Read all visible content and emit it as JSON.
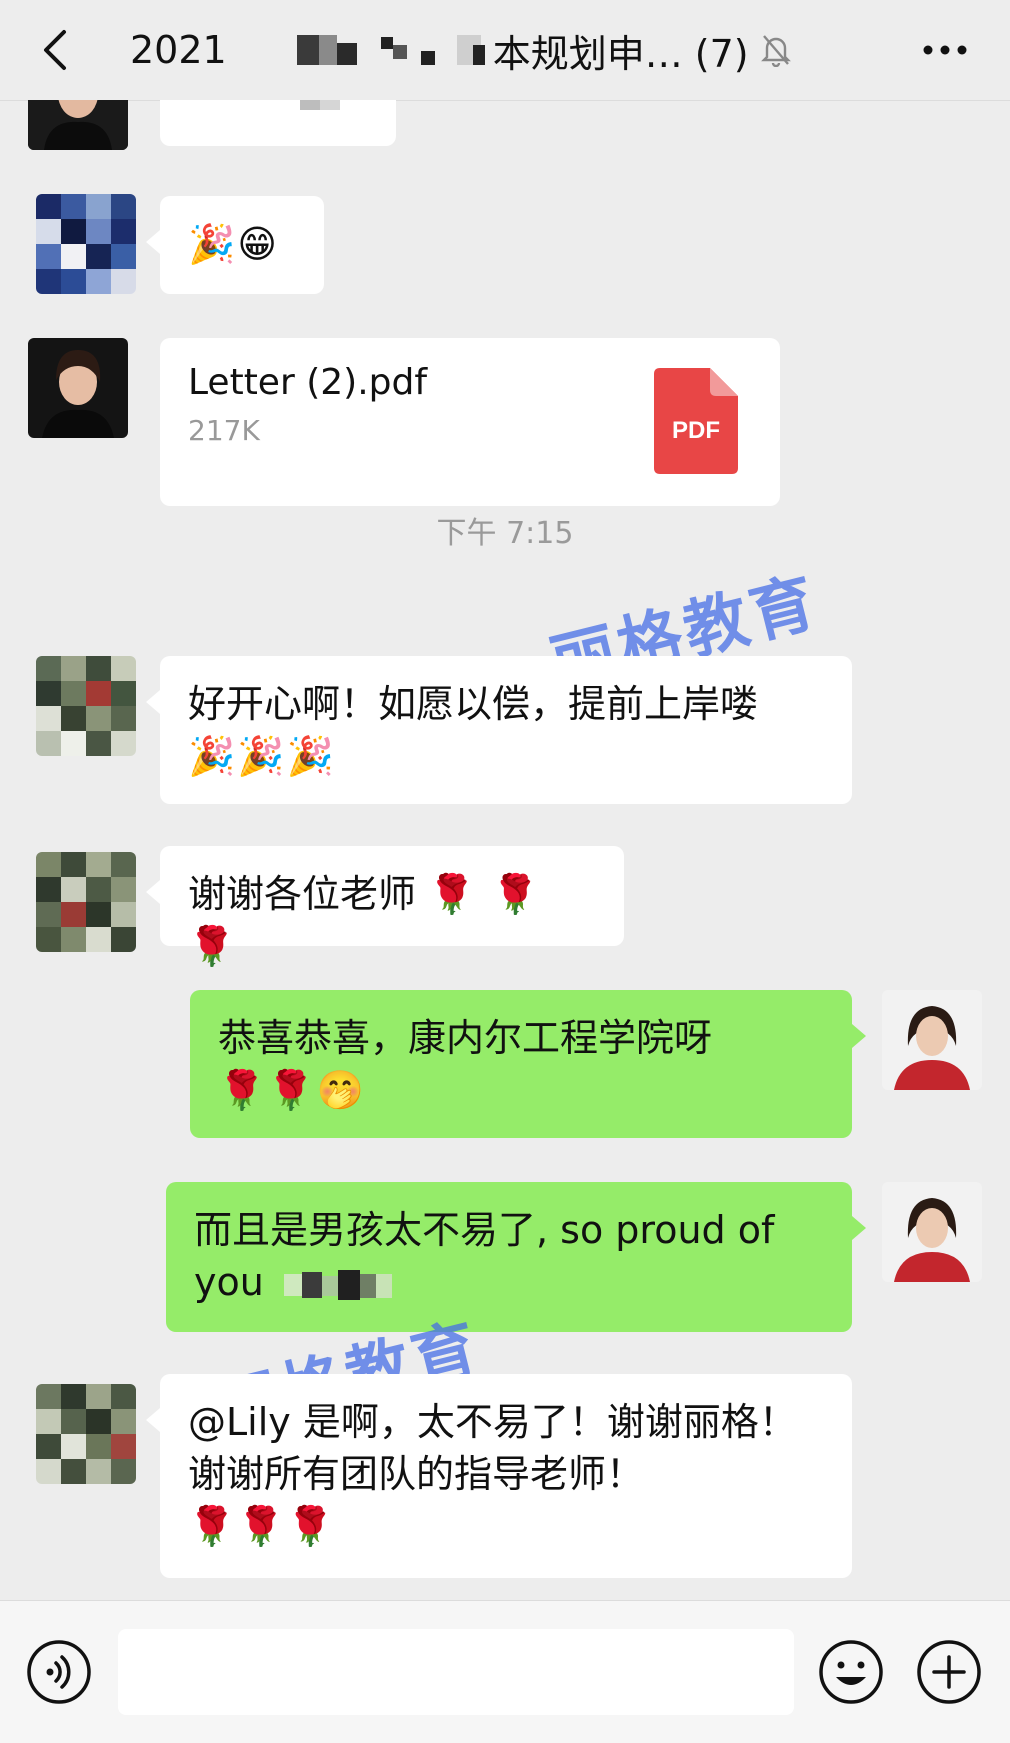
{
  "header": {
    "title_prefix": "2021",
    "title_suffix": "本规划申… (7)"
  },
  "messages": [
    {
      "id": "m2",
      "sender": "other",
      "emojis": "🎉😁"
    },
    {
      "id": "m3",
      "sender": "other",
      "type": "file",
      "file_name": "Letter (2).pdf",
      "file_size": "217K",
      "file_type_label": "PDF"
    },
    {
      "id": "m4",
      "sender": "other",
      "text": "好开心啊！如愿以偿，提前上岸喽",
      "emojis": "🎉🎉🎉"
    },
    {
      "id": "m5",
      "sender": "other",
      "text": "谢谢各位老师",
      "emojis": "🌹 🌹 🌹"
    },
    {
      "id": "m6",
      "sender": "me",
      "text": "恭喜恭喜，康内尔工程学院呀",
      "emojis": "🌹🌹🤭"
    },
    {
      "id": "m7",
      "sender": "me",
      "text": "而且是男孩太不易了, so proud of you"
    },
    {
      "id": "m8",
      "sender": "other",
      "text": "@Lily 是啊，太不易了！谢谢丽格！谢谢所有团队的指导老师！",
      "emojis": "🌹🌹🌹"
    }
  ],
  "timestamp": "下午 7:15",
  "watermarks": [
    "丽格教育",
    "丽格教育"
  ],
  "input_bar": {
    "placeholder": ""
  },
  "colors": {
    "bubble_me": "#95ec69",
    "bubble_other": "#ffffff",
    "background": "#ededed",
    "watermark": "#466ee6",
    "pdf_red": "#e84646"
  }
}
